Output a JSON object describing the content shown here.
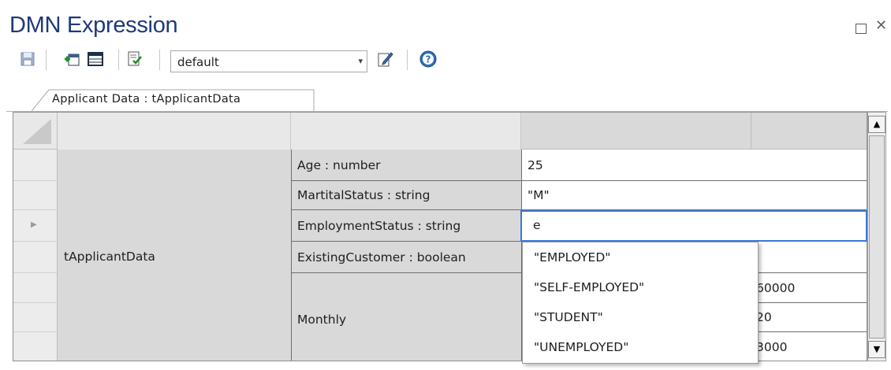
{
  "window": {
    "title": "DMN Expression",
    "restore_glyph": "",
    "close_glyph": "✕"
  },
  "toolbar": {
    "combo_value": "default",
    "combo_arrow": "▾",
    "icons": [
      "save-icon",
      "add-row-icon",
      "table-icon",
      "validate-icon",
      "edit-icon",
      "help-icon"
    ]
  },
  "tab": {
    "label": "Applicant Data : tApplicantData"
  },
  "grid": {
    "type_name": "tApplicantData",
    "rows": [
      {
        "field": "Age : number",
        "value": "25"
      },
      {
        "field": "MartitalStatus : string",
        "value": "\"M\""
      },
      {
        "field": "EmploymentStatus : string",
        "value": "e"
      },
      {
        "field": "ExistingCustomer : boolean",
        "value": ""
      }
    ],
    "monthly": {
      "label": "Monthly",
      "values": [
        "60000",
        "20",
        "3000"
      ]
    }
  },
  "scrollbar": {
    "up_glyph": "▲",
    "down_glyph": "▼"
  },
  "autocomplete": {
    "options": [
      "\"EMPLOYED\"",
      "\"SELF-EMPLOYED\"",
      "\"STUDENT\"",
      "\"UNEMPLOYED\""
    ]
  },
  "colors": {
    "title": "#1e3a78",
    "focus_border": "#3b78d8",
    "cell_gray": "#d9d9d9"
  }
}
